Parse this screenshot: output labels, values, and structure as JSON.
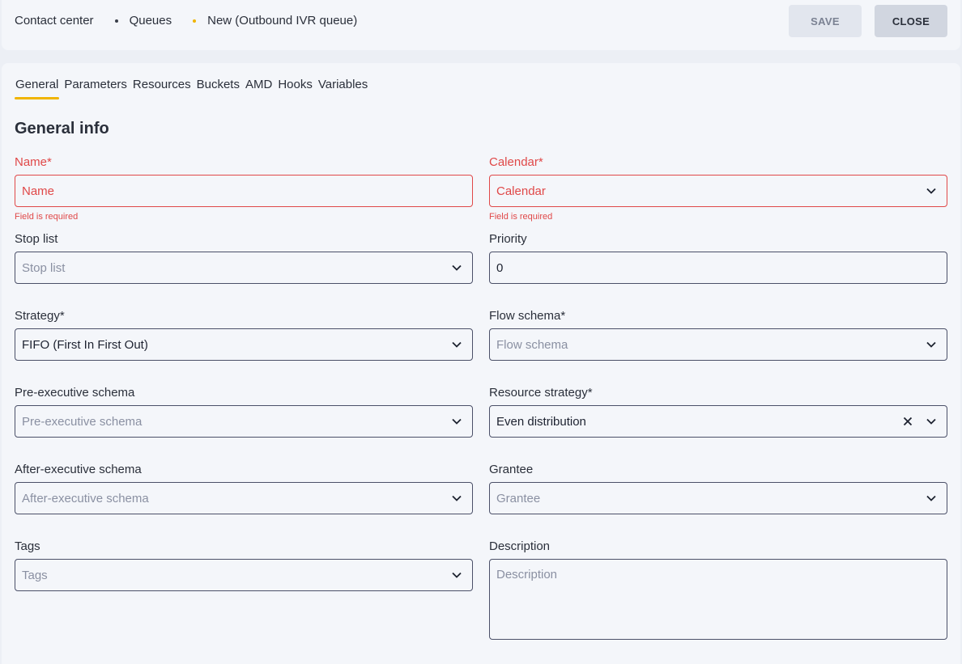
{
  "breadcrumb": {
    "items": [
      "Contact center",
      "Queues",
      "New (Outbound IVR queue)"
    ]
  },
  "header": {
    "save_label": "SAVE",
    "close_label": "CLOSE"
  },
  "tabs": [
    "General",
    "Parameters",
    "Resources",
    "Buckets",
    "AMD",
    "Hooks",
    "Variables"
  ],
  "section_title": "General info",
  "fields": {
    "name": {
      "label": "Name*",
      "placeholder": "Name",
      "error": "Field is required"
    },
    "calendar": {
      "label": "Calendar*",
      "placeholder": "Calendar",
      "error": "Field is required"
    },
    "stop_list": {
      "label": "Stop list",
      "placeholder": "Stop list"
    },
    "priority": {
      "label": "Priority",
      "value": "0"
    },
    "strategy": {
      "label": "Strategy*",
      "value": "FIFO (First In First Out)"
    },
    "flow_schema": {
      "label": "Flow schema*",
      "placeholder": "Flow schema"
    },
    "pre_exec": {
      "label": "Pre-executive schema",
      "placeholder": "Pre-executive schema"
    },
    "resource_strategy": {
      "label": "Resource strategy*",
      "value": "Even distribution"
    },
    "after_exec": {
      "label": "After-executive schema",
      "placeholder": "After-executive schema"
    },
    "grantee": {
      "label": "Grantee",
      "placeholder": "Grantee"
    },
    "tags": {
      "label": "Tags",
      "placeholder": "Tags"
    },
    "description": {
      "label": "Description",
      "placeholder": "Description"
    }
  },
  "colors": {
    "accent": "#f0b400",
    "error": "#e04848",
    "border": "#4b5068"
  },
  "icons": {
    "dropdown": "chevron-down-icon",
    "clear": "close-icon"
  }
}
